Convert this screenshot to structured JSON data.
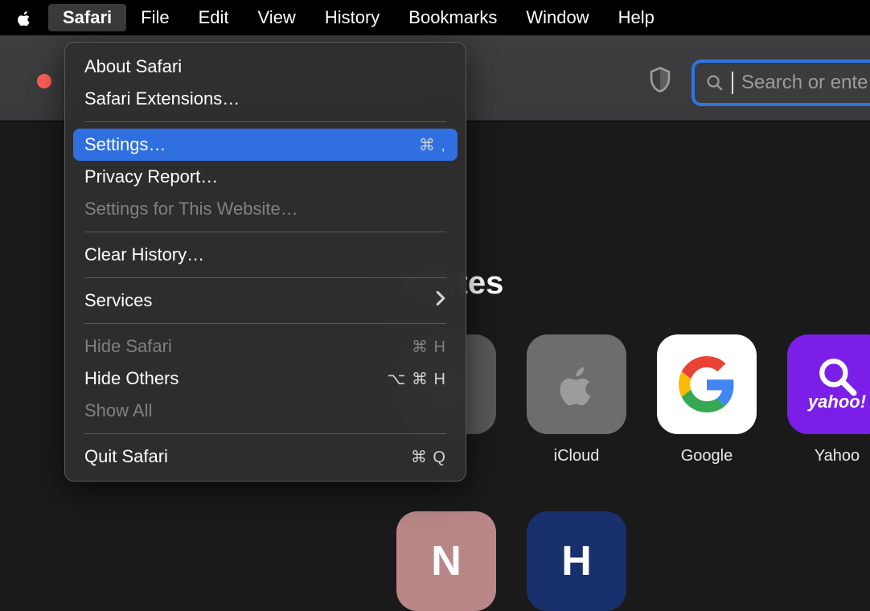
{
  "menubar": {
    "app": "Safari",
    "items": [
      "File",
      "Edit",
      "View",
      "History",
      "Bookmarks",
      "Window",
      "Help"
    ]
  },
  "toolbar": {
    "search_placeholder": "Search or ente"
  },
  "dropdown": {
    "groups": [
      [
        {
          "label": "About Safari",
          "shortcut": "",
          "disabled": false,
          "highlighted": false,
          "submenu": false
        },
        {
          "label": "Safari Extensions…",
          "shortcut": "",
          "disabled": false,
          "highlighted": false,
          "submenu": false
        }
      ],
      [
        {
          "label": "Settings…",
          "shortcut": "⌘ ,",
          "disabled": false,
          "highlighted": true,
          "submenu": false
        },
        {
          "label": "Privacy Report…",
          "shortcut": "",
          "disabled": false,
          "highlighted": false,
          "submenu": false
        },
        {
          "label": "Settings for This Website…",
          "shortcut": "",
          "disabled": true,
          "highlighted": false,
          "submenu": false
        }
      ],
      [
        {
          "label": "Clear History…",
          "shortcut": "",
          "disabled": false,
          "highlighted": false,
          "submenu": false
        }
      ],
      [
        {
          "label": "Services",
          "shortcut": "",
          "disabled": false,
          "highlighted": false,
          "submenu": true
        }
      ],
      [
        {
          "label": "Hide Safari",
          "shortcut": "⌘ H",
          "disabled": true,
          "highlighted": false,
          "submenu": false
        },
        {
          "label": "Hide Others",
          "shortcut": "⌥ ⌘ H",
          "disabled": false,
          "highlighted": false,
          "submenu": false
        },
        {
          "label": "Show All",
          "shortcut": "",
          "disabled": true,
          "highlighted": false,
          "submenu": false
        }
      ],
      [
        {
          "label": "Quit Safari",
          "shortcut": "⌘ Q",
          "disabled": false,
          "highlighted": false,
          "submenu": false
        }
      ]
    ]
  },
  "favourites": {
    "title": "ourites",
    "row1": [
      {
        "label": "e",
        "tile": "apple"
      },
      {
        "label": "iCloud",
        "tile": "icloud"
      },
      {
        "label": "Google",
        "tile": "google"
      },
      {
        "label": "Yahoo",
        "tile": "yahoo"
      }
    ],
    "row2": [
      {
        "label": "",
        "tile": "n",
        "letter": "N"
      },
      {
        "label": "",
        "tile": "h",
        "letter": "H"
      }
    ]
  },
  "yahoo_text": "yahoo!"
}
